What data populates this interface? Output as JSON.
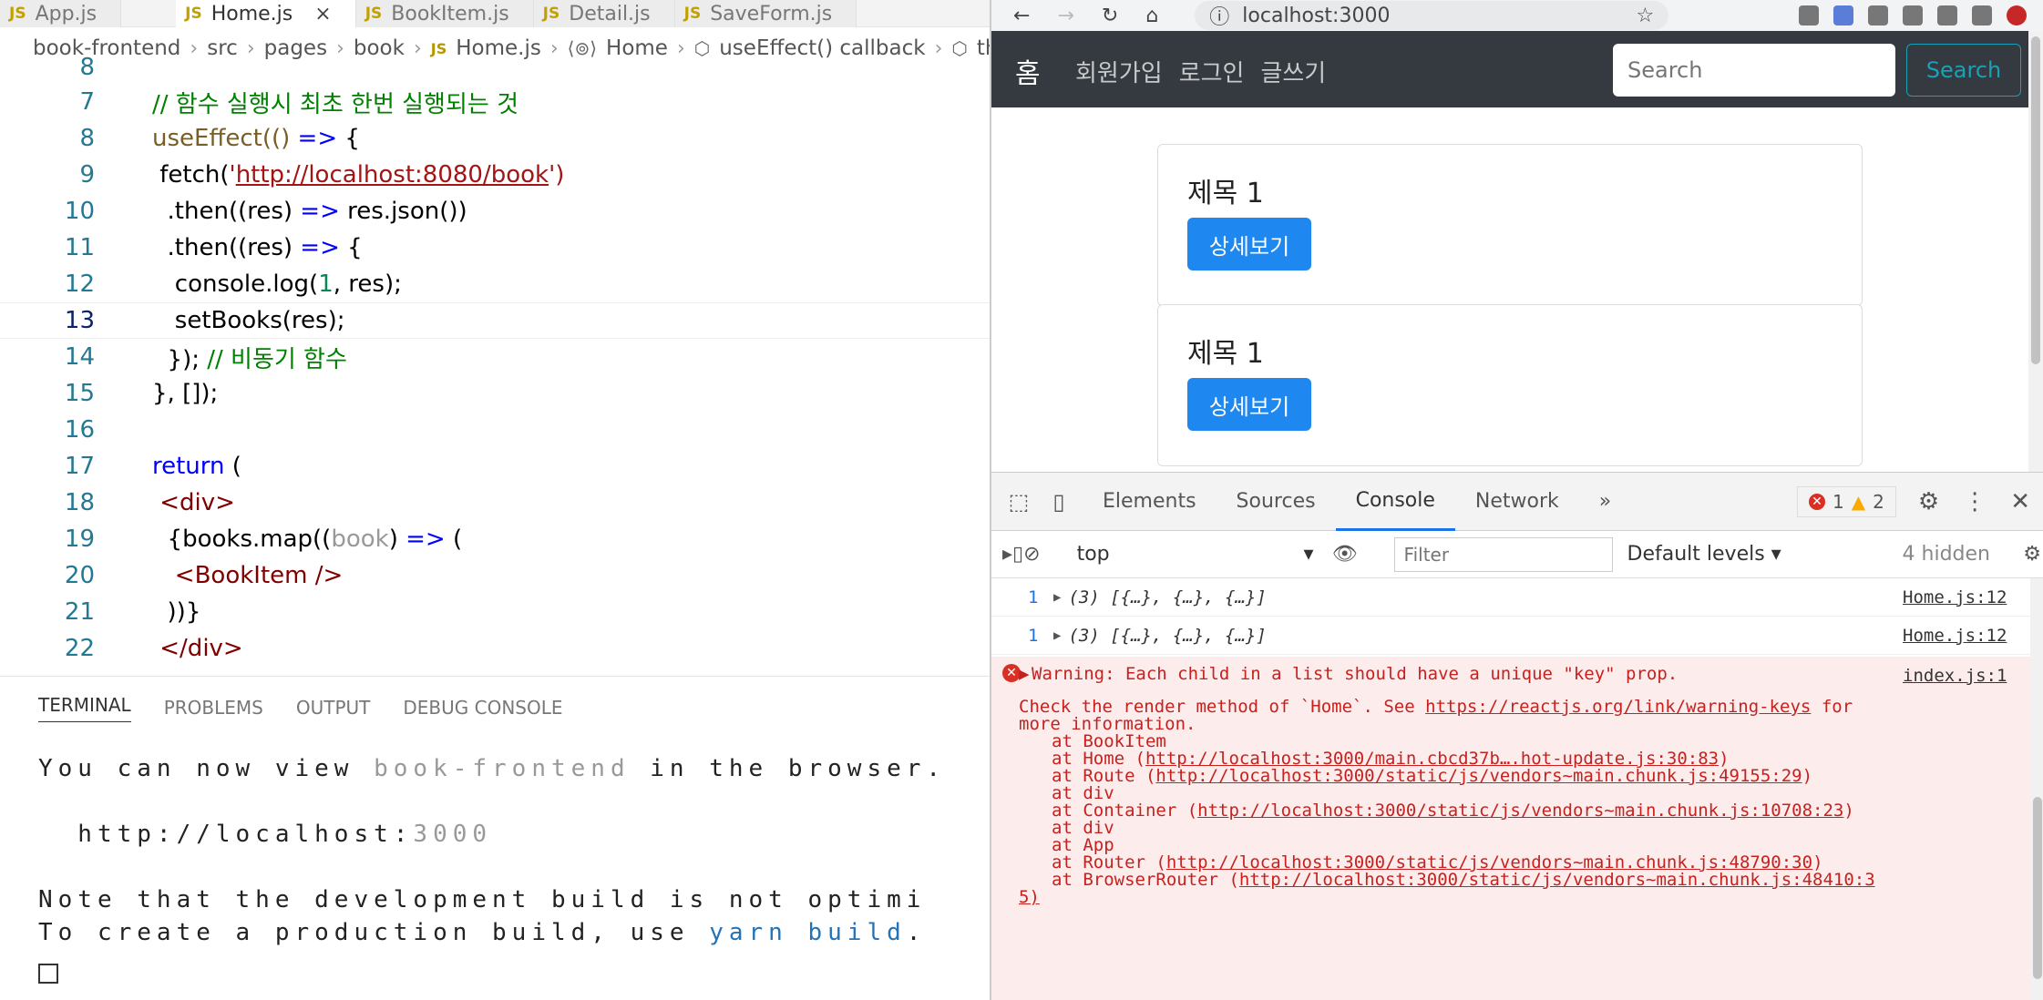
{
  "editor": {
    "tabs": [
      "App.js",
      "Home.js",
      "BookItem.js",
      "Detail.js",
      "SaveForm.js"
    ],
    "breadcrumb": [
      "book-frontend",
      "src",
      "pages",
      "book",
      "Home.js",
      "Home",
      "useEffect() callback",
      "then()"
    ],
    "line_numbers": [
      "8",
      "7",
      "8",
      "9",
      "10",
      "11",
      "12",
      "13",
      "14",
      "15",
      "16",
      "17",
      "18",
      "19",
      "20",
      "21",
      "22"
    ],
    "code": {
      "l7": "// 함수 실행시 최초 한번 실행되는 것",
      "l8a": "useEffect(() ",
      "l8b": "=>",
      "l8c": " {",
      "l9a": " fetch(",
      "l9b": "'",
      "l9c": "http://localhost:8080/book",
      "l9d": "')",
      "l10a": "  .then((res) ",
      "l10b": "=>",
      "l10c": " res.json())",
      "l11a": "  .then((res) ",
      "l11b": "=>",
      "l11c": " {",
      "l12a": "   console.log(",
      "l12b": "1",
      "l12c": ", res);",
      "l13": "   setBooks(res);",
      "l14a": "  }); ",
      "l14b": "// 비동기 함수",
      "l15": "}, []);",
      "l17a": "return",
      "l17b": " (",
      "l18": " <div>",
      "l19a": "  {books.map((",
      "l19b": "book",
      "l19c": ") ",
      "l19d": "=>",
      "l19e": " (",
      "l20": "   <BookItem />",
      "l21": "  ))}",
      "l22": " </div>"
    }
  },
  "panel": {
    "tabs": [
      "TERMINAL",
      "PROBLEMS",
      "OUTPUT",
      "DEBUG CONSOLE"
    ],
    "terminal": {
      "line1a": "You can now view ",
      "line1b": "book-frontend",
      "line1c": " in the browser.",
      "line2a": "  http://localhost:",
      "line2b": "3000",
      "line3": "Note that the development build is not optimi",
      "line4a": "To create a production build, use ",
      "line4b": "yarn build",
      "line4c": "."
    }
  },
  "browser": {
    "url": "localhost:3000",
    "navbar": {
      "brand": "홈",
      "links": [
        "회원가입",
        "로그인",
        "글쓰기"
      ],
      "search_placeholder": "Search",
      "search_button": "Search"
    },
    "cards": [
      {
        "title": "제목 1",
        "button": "상세보기"
      },
      {
        "title": "제목 1",
        "button": "상세보기"
      }
    ]
  },
  "devtools": {
    "tabs": [
      "Elements",
      "Sources",
      "Console",
      "Network"
    ],
    "more": "»",
    "error_count": "1",
    "warning_count": "2",
    "context": "top",
    "filter_placeholder": "Filter",
    "levels": "Default levels ▾",
    "hidden": "4 hidden",
    "logs": [
      {
        "count": "1",
        "text": "(3) [{…}, {…}, {…}]",
        "source": "Home.js:12"
      },
      {
        "count": "1",
        "text": "(3) [{…}, {…}, {…}]",
        "source": "Home.js:12"
      }
    ],
    "warning": {
      "title": "Warning: Each child in a list should have a unique \"key\" prop.",
      "source": "index.js:1",
      "check_a": "Check the render method of `Home`. See ",
      "check_link": "https://reactjs.org/link/warning-keys",
      "check_b": " for",
      "more": "more information.",
      "stack": [
        {
          "text": "at BookItem",
          "link": ""
        },
        {
          "text": "at Home (",
          "link": "http://localhost:3000/main.cbcd37b….hot-update.js:30:83",
          "end": ")"
        },
        {
          "text": "at Route (",
          "link": "http://localhost:3000/static/js/vendors~main.chunk.js:49155:29",
          "end": ")"
        },
        {
          "text": "at div",
          "link": ""
        },
        {
          "text": "at Container (",
          "link": "http://localhost:3000/static/js/vendors~main.chunk.js:10708:23",
          "end": ")"
        },
        {
          "text": "at div",
          "link": ""
        },
        {
          "text": "at App",
          "link": ""
        },
        {
          "text": "at Router (",
          "link": "http://localhost:3000/static/js/vendors~main.chunk.js:48790:30",
          "end": ")"
        },
        {
          "text": "at BrowserRouter (",
          "link": "http://localhost:3000/static/js/vendors~main.chunk.js:48410:3",
          "end": ""
        }
      ],
      "tail": "5)"
    }
  }
}
